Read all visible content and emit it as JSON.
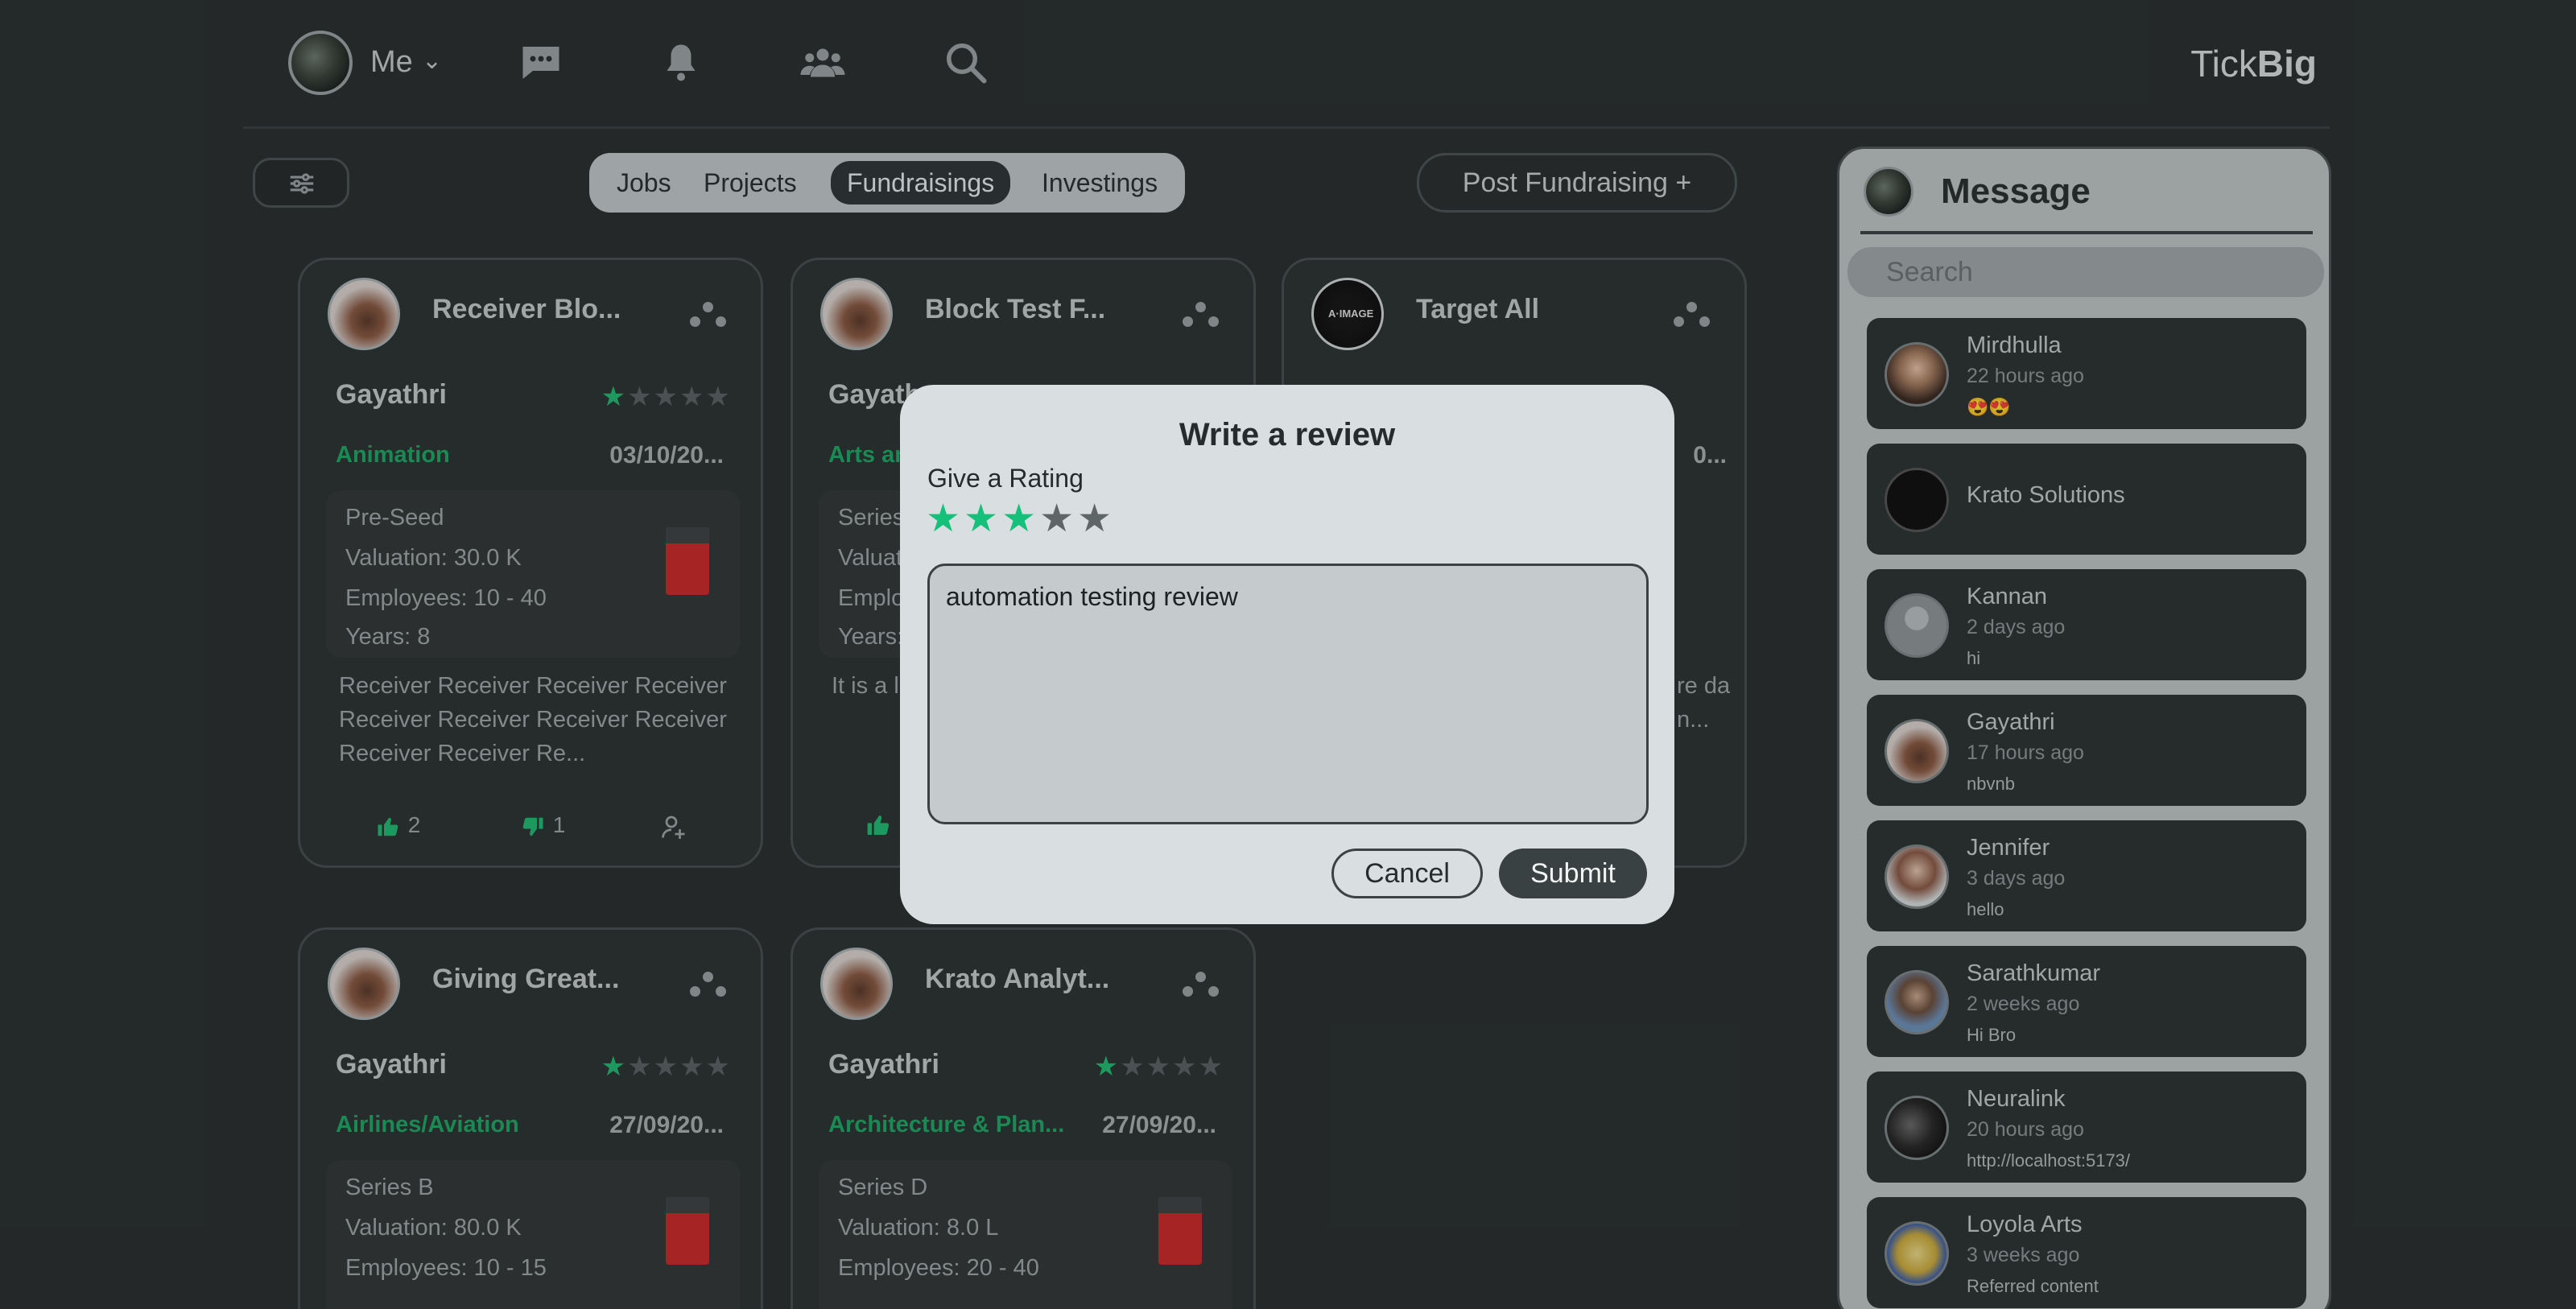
{
  "nav": {
    "me_label": "Me",
    "brand_light": "Tick",
    "brand_bold": "Big",
    "icons": [
      "chat-icon",
      "bell-icon",
      "people-icon",
      "search-icon"
    ]
  },
  "toolbar": {
    "tabs": [
      "Jobs",
      "Projects",
      "Fundraisings",
      "Investings"
    ],
    "active_tab": "Fundraisings",
    "post_button": "Post Fundraising +"
  },
  "cards": [
    {
      "title": "Receiver Blo...",
      "owner": "Gayathri",
      "rating": 1,
      "category": "Animation",
      "date": "03/10/20...",
      "stage": "Pre-Seed",
      "valuation": "Valuation: 30.0 K",
      "employees": "Employees: 10 - 40",
      "years": "Years: 8",
      "description": "Receiver Receiver Receiver Receiver Receiver Receiver Receiver Receiver Receiver Receiver Re...",
      "likes": "2",
      "dislikes": "1"
    },
    {
      "title": "Block Test F...",
      "owner": "Gayath",
      "category": "Arts an",
      "stage": "Series",
      "valuation": "Valuati",
      "employees": "Employ",
      "years": "Years: ",
      "description": "It is a l ader w ble co"
    },
    {
      "title": "Target All",
      "owner_partial": "",
      "date": "0...",
      "desc_tail": "re da n..."
    },
    {
      "title": "Giving Great...",
      "owner": "Gayathri",
      "rating": 1,
      "category": "Airlines/Aviation",
      "date": "27/09/20...",
      "stage": "Series B",
      "valuation": "Valuation: 80.0 K",
      "employees": "Employees: 10 - 15"
    },
    {
      "title": "Krato Analyt...",
      "owner": "Gayathri",
      "rating": 1,
      "category": "Architecture & Plan...",
      "date": "27/09/20...",
      "stage": "Series D",
      "valuation": "Valuation: 8.0 L",
      "employees": "Employees: 20 - 40"
    }
  ],
  "messages": {
    "title": "Message",
    "search_placeholder": "Search",
    "conversations": [
      {
        "name": "Mirdhulla",
        "time": "22 hours ago",
        "last": "😍😍"
      },
      {
        "name": "Krato Solutions",
        "time": "",
        "last": ""
      },
      {
        "name": "Kannan",
        "time": "2 days ago",
        "last": "hi"
      },
      {
        "name": "Gayathri",
        "time": "17 hours ago",
        "last": "nbvnb"
      },
      {
        "name": "Jennifer",
        "time": "3 days ago",
        "last": "hello"
      },
      {
        "name": "Sarathkumar",
        "time": "2 weeks ago",
        "last": "Hi Bro"
      },
      {
        "name": "Neuralink",
        "time": "20 hours ago",
        "last": "http://localhost:5173/"
      },
      {
        "name": "Loyola Arts",
        "time": "3 weeks ago",
        "last": "Referred content"
      }
    ]
  },
  "modal": {
    "title": "Write a review",
    "rating_label": "Give a Rating",
    "rating": 3,
    "max_rating": 5,
    "review_text": "automation testing review",
    "cancel_label": "Cancel",
    "submit_label": "Submit"
  },
  "colors": {
    "accent_green": "#14c07a",
    "background": "#2a2f30",
    "panel": "#bcc2c4"
  }
}
